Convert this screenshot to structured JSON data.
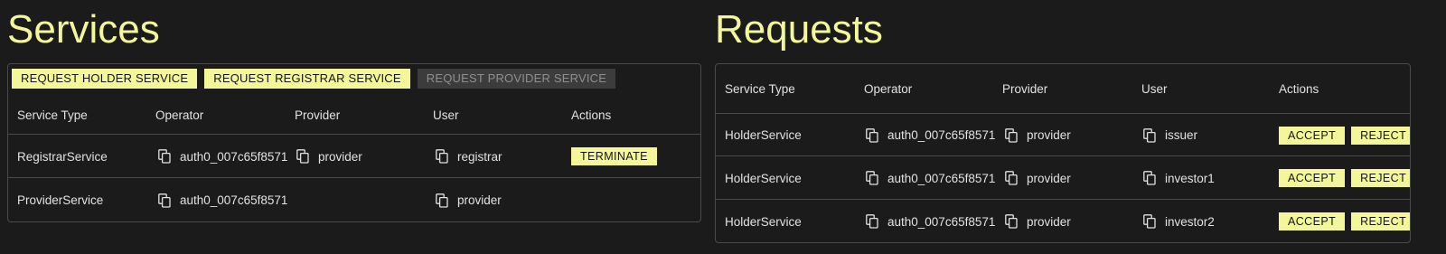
{
  "services": {
    "title": "Services",
    "toolbar": {
      "holder_label": "REQUEST HOLDER SERVICE",
      "registrar_label": "REQUEST REGISTRAR SERVICE",
      "provider_label": "REQUEST PROVIDER SERVICE"
    },
    "columns": [
      "Service Type",
      "Operator",
      "Provider",
      "User",
      "Actions"
    ],
    "rows": [
      {
        "service_type": "RegistrarService",
        "operator": "auth0_007c65f8571",
        "provider": "provider",
        "user": "registrar",
        "action_label": "TERMINATE"
      },
      {
        "service_type": "ProviderService",
        "operator": "auth0_007c65f8571",
        "provider": "",
        "user": "provider",
        "action_label": ""
      }
    ]
  },
  "requests": {
    "title": "Requests",
    "columns": [
      "Service Type",
      "Operator",
      "Provider",
      "User",
      "Actions"
    ],
    "rows": [
      {
        "service_type": "HolderService",
        "operator": "auth0_007c65f8571",
        "provider": "provider",
        "user": "issuer",
        "accept_label": "ACCEPT",
        "reject_label": "REJECT"
      },
      {
        "service_type": "HolderService",
        "operator": "auth0_007c65f8571",
        "provider": "provider",
        "user": "investor1",
        "accept_label": "ACCEPT",
        "reject_label": "REJECT"
      },
      {
        "service_type": "HolderService",
        "operator": "auth0_007c65f8571",
        "provider": "provider",
        "user": "investor2",
        "accept_label": "ACCEPT",
        "reject_label": "REJECT"
      }
    ]
  },
  "icons": {
    "copy": "copy-icon"
  },
  "colors": {
    "background": "#1b1b1b",
    "accent": "#f3f79a",
    "border": "#4a4a4a",
    "disabled_bg": "#3c3c3c",
    "disabled_text": "#8f8f8f",
    "text": "#e2e2e2"
  }
}
